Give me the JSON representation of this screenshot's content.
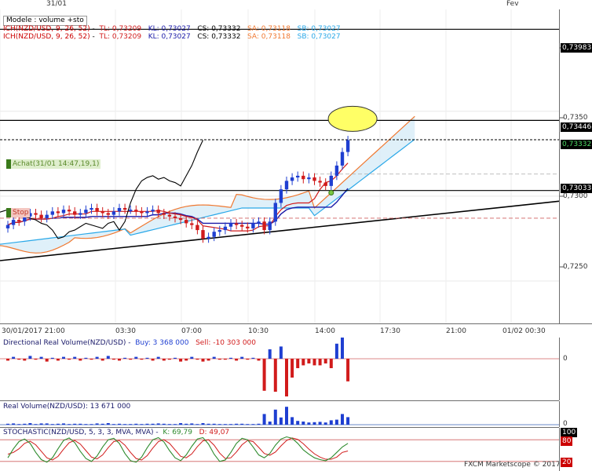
{
  "top_dates": {
    "d1": "31/01",
    "d2": "Fev"
  },
  "header": {
    "model_label": "Modele : volume +sto",
    "ich1": {
      "name": "ICH(NZD/USD, 9, 26, 52)",
      "tl": "TL: 0,73209",
      "kl": "KL: 0,73027",
      "cs": "CS: 0,73332",
      "sa": "SA: 0,73118",
      "sb": "SB: 0,73027"
    },
    "ich2": {
      "name": "ICH(NZD/USD, 9, 26, 52)",
      "tl": "TL: 0,73209",
      "kl": "KL: 0,73027",
      "cs": "CS: 0,73332",
      "sa": "SA: 0,73118",
      "sb": "SB: 0,73027"
    }
  },
  "price_tags": {
    "p1": "0,73983",
    "p2": "0,7350",
    "p3": "0,73446",
    "p4": "0,73332",
    "p5": "0,73033",
    "p6": "0,7300",
    "p7": "0,7250"
  },
  "order_tags": {
    "achat": "Achat(31/01 14:47,19,1)",
    "stop": "Stop"
  },
  "time_labels": [
    "30/01/2017 21:00",
    "03:30",
    "07:00",
    "10:30",
    "14:00",
    "17:30",
    "21:00",
    "01/02 00:30"
  ],
  "sub1": {
    "title": "Directional Real Volume(NZD/USD) -",
    "buy": "Buy: 3 368 000",
    "sell": "Sell: -10 303 000",
    "zero": "0"
  },
  "sub2": {
    "title": "Real Volume(NZD/USD): 13 671 000",
    "zero": "0"
  },
  "sub3": {
    "title": "STOCHASTIC(NZD/USD, 5, 3, 3, MVA, MVA) -",
    "k": "K: 69,79",
    "d": "D: 49,07",
    "l100": "100",
    "l80": "80",
    "l20": "20"
  },
  "footer": "FXCM Marketscope © 2017",
  "colors": {
    "bull": "#1f3fd1",
    "bear": "#d11b1b",
    "tenkan": "#d11b1b",
    "kijun": "#1a1aa8",
    "chikou": "#000000",
    "senkou_a": "#f07830",
    "senkou_b": "#2aa8e8",
    "cloud": "#d7ecf8",
    "highlight": "#ffff66"
  },
  "chart_data": {
    "type": "candlestick",
    "pair": "NZD/USD",
    "price_levels": [
      0.73983,
      0.73446,
      0.73332,
      0.73033
    ],
    "y_range": [
      0.7225,
      0.741
    ],
    "closes": [
      0.7283,
      0.7286,
      0.7285,
      0.7288,
      0.729,
      0.7289,
      0.7287,
      0.7289,
      0.7291,
      0.729,
      0.7292,
      0.7291,
      0.7289,
      0.729,
      0.7292,
      0.7293,
      0.7291,
      0.729,
      0.7289,
      0.7291,
      0.7293,
      0.7292,
      0.7292,
      0.7291,
      0.729,
      0.7291,
      0.7292,
      0.729,
      0.7289,
      0.7288,
      0.7287,
      0.7286,
      0.7284,
      0.7283,
      0.728,
      0.7275,
      0.7276,
      0.7279,
      0.728,
      0.7282,
      0.7284,
      0.7283,
      0.7282,
      0.7281,
      0.7284,
      0.7285,
      0.728,
      0.7285,
      0.7296,
      0.7304,
      0.7309,
      0.7311,
      0.7312,
      0.731,
      0.7311,
      0.7309,
      0.7308,
      0.7306,
      0.7312,
      0.7318,
      0.7326,
      0.7333
    ],
    "directional_volume": [
      -0.2,
      0.2,
      -0.1,
      -0.2,
      0.3,
      -0.1,
      0.2,
      -0.3,
      0.1,
      -0.2,
      0.2,
      -0.1,
      0.2,
      -0.2,
      0.1,
      -0.1,
      0.2,
      -0.2,
      0.3,
      -0.1,
      -0.2,
      0.1,
      -0.1,
      0.2,
      -0.1,
      0.1,
      -0.2,
      0.2,
      -0.2,
      -0.1,
      0.1,
      -0.3,
      -0.2,
      0.2,
      -0.1,
      -0.3,
      -0.2,
      0.2,
      -0.1,
      -0.1,
      0.1,
      -0.2,
      0.2,
      -0.1,
      0.1,
      -0.2,
      -3.4,
      1.0,
      -3.5,
      1.3,
      -4.0,
      -2.0,
      -1.0,
      -0.7,
      -0.5,
      -0.7,
      -0.7,
      -0.5,
      -1.0,
      1.6,
      3.4,
      -2.4
    ],
    "real_volume": [
      0.3,
      0.4,
      0.2,
      0.3,
      0.5,
      0.2,
      0.4,
      0.4,
      0.2,
      0.3,
      0.4,
      0.2,
      0.3,
      0.3,
      0.2,
      0.2,
      0.4,
      0.3,
      0.5,
      0.2,
      0.3,
      0.2,
      0.2,
      0.3,
      0.2,
      0.3,
      0.3,
      0.4,
      0.3,
      0.2,
      0.2,
      0.5,
      0.3,
      0.4,
      0.2,
      0.5,
      0.3,
      0.3,
      0.2,
      0.2,
      0.2,
      0.3,
      0.3,
      0.2,
      0.2,
      0.3,
      3.4,
      1.0,
      4.8,
      2.3,
      5.7,
      2.4,
      1.2,
      1.0,
      0.7,
      0.8,
      0.9,
      0.7,
      1.4,
      1.6,
      3.4,
      2.4
    ],
    "stochastic_k": [
      30,
      55,
      75,
      82,
      70,
      45,
      25,
      18,
      30,
      55,
      78,
      85,
      72,
      48,
      28,
      20,
      35,
      60,
      80,
      84,
      70,
      42,
      22,
      18,
      32,
      58,
      80,
      86,
      74,
      50,
      30,
      22,
      38,
      62,
      82,
      86,
      68,
      40,
      20,
      24,
      45,
      70,
      84,
      80,
      60,
      38,
      30,
      42,
      65,
      82,
      88,
      84,
      70,
      52,
      40,
      30,
      25,
      22,
      30,
      45,
      60,
      70
    ],
    "stochastic_d": [
      40,
      45,
      55,
      70,
      76,
      66,
      48,
      30,
      24,
      34,
      54,
      72,
      78,
      68,
      50,
      32,
      27,
      38,
      58,
      75,
      78,
      65,
      45,
      28,
      24,
      36,
      57,
      75,
      80,
      70,
      52,
      34,
      30,
      41,
      61,
      77,
      80,
      65,
      43,
      28,
      30,
      46,
      66,
      78,
      75,
      59,
      42,
      37,
      46,
      63,
      78,
      85,
      81,
      69,
      54,
      41,
      32,
      26,
      26,
      32,
      45,
      49
    ]
  }
}
